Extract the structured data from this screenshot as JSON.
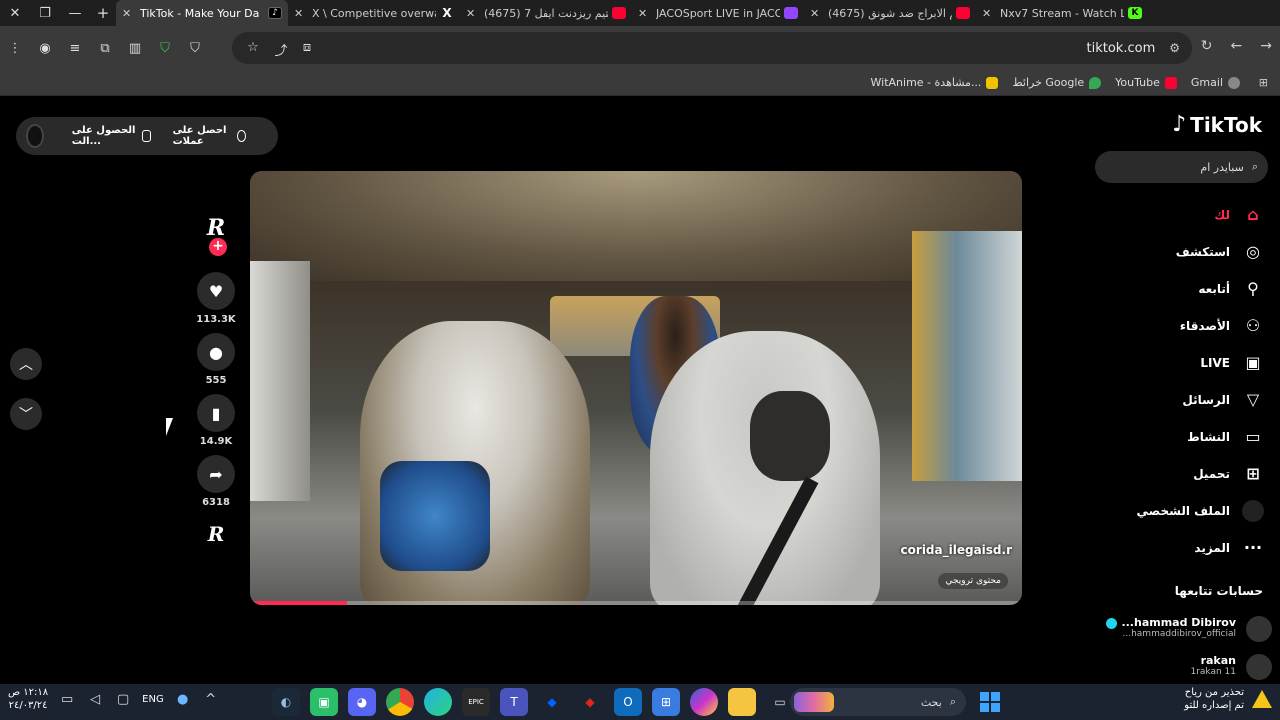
{
  "browser": {
    "window_controls": {
      "close": "✕",
      "restore": "❐",
      "minimize": "—",
      "new_tab": "+"
    },
    "tabs": [
      {
        "title": "TikTok - Make Your Da",
        "favicon": "tiktok-icon",
        "active": true
      },
      {
        "title": "X \\ Competitive overwatch",
        "favicon": "x-icon",
        "active": false
      },
      {
        "title": "(4675) تختيم ريزدنت ايفل 7",
        "favicon": "youtube-icon",
        "active": false
      },
      {
        "title": "JACOSport LIVE in JACO - J",
        "favicon": "twitch-icon",
        "active": false
      },
      {
        "title": "(4675) تيم الابراج ضد شونق",
        "favicon": "youtube-icon",
        "active": false
      },
      {
        "title": "Nxv7 Stream - Watch Live",
        "favicon": "kick-icon",
        "active": false
      }
    ],
    "url": "tiktok.com",
    "bookmarks": [
      {
        "label": "Gmail",
        "color": "#ea4335"
      },
      {
        "label": "YouTube",
        "color": "#ff0033"
      },
      {
        "label": "خرائط Google",
        "color": "#34a853"
      },
      {
        "label": "WitAnime - مشاهدة...",
        "color": "#f2c200"
      }
    ]
  },
  "tiktok": {
    "brand": "TikTok",
    "search_placeholder": "سبايدر ام",
    "get_app": {
      "coins": "احصل على عملات",
      "app": "الحصول على الت..."
    },
    "nav": [
      {
        "label": "لك",
        "icon": "home-icon",
        "active": true
      },
      {
        "label": "استكشف",
        "icon": "compass-icon",
        "active": false
      },
      {
        "label": "أتابعه",
        "icon": "following-icon",
        "active": false
      },
      {
        "label": "الأصدقاء",
        "icon": "friends-icon",
        "active": false
      },
      {
        "label": "LIVE",
        "icon": "live-icon",
        "active": false
      },
      {
        "label": "الرسائل",
        "icon": "send-icon",
        "active": false
      },
      {
        "label": "النشاط",
        "icon": "activity-icon",
        "active": false
      },
      {
        "label": "تحميل",
        "icon": "upload-icon",
        "active": false
      },
      {
        "label": "الملف الشخصي",
        "icon": "profile-avatar",
        "active": false
      },
      {
        "label": "المزيد",
        "icon": "more-icon",
        "active": false
      }
    ],
    "following_title": "حسابات تتابعها",
    "following_accounts": [
      {
        "name": "...hammad Dibirov",
        "handle": "...hammaddibirov_official",
        "verified": true
      },
      {
        "name": "rakan",
        "handle": "1rakan 11",
        "verified": false
      }
    ],
    "video": {
      "watermark": "corida_ilegaisd.r",
      "badge": "محتوى ترويجي",
      "progress": 0.125
    },
    "creator_initial": "R",
    "actions": {
      "likes": "113.3K",
      "comments": "555",
      "saves": "14.9K",
      "shares": "6318"
    }
  },
  "taskbar": {
    "clock_time": "١٢:١٨ ص",
    "clock_date": "٢٤/٠٣/٢٤",
    "language": "ENG",
    "search_label": "بحث",
    "notification_line1": "تحذير من رياح",
    "notification_line2": "تم إصداره للتو"
  }
}
